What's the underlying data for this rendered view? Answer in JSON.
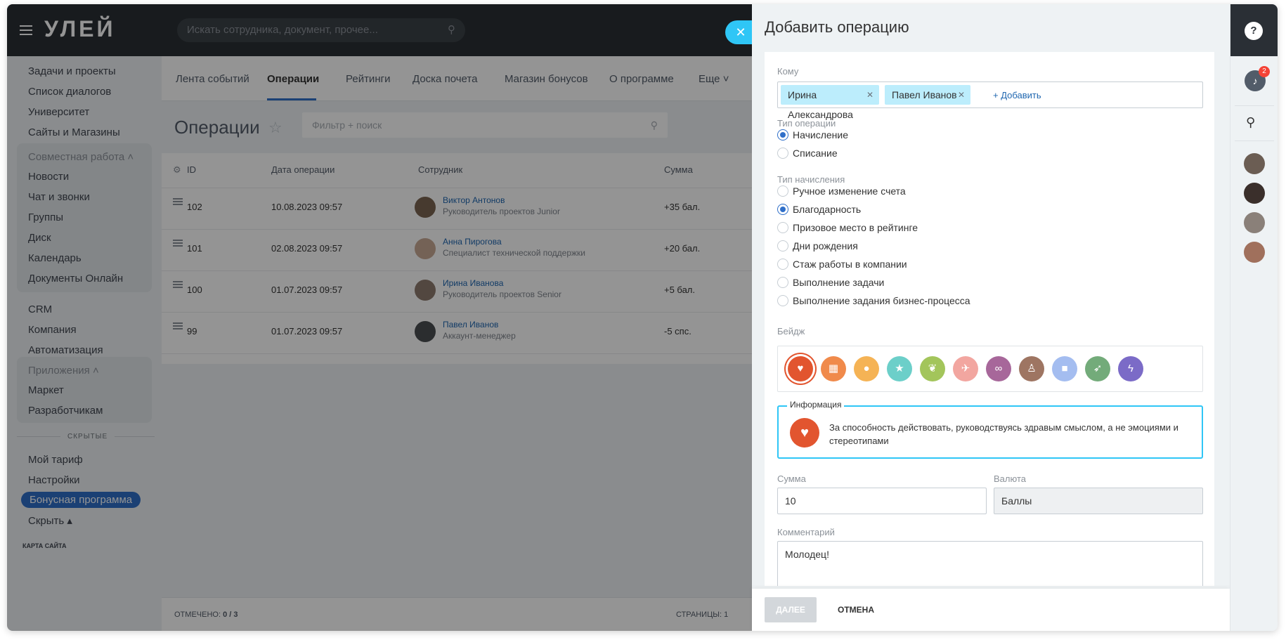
{
  "header": {
    "logo": "УЛЕЙ",
    "search_placeholder": "Искать сотрудника, документ, прочее..."
  },
  "sidebar": {
    "items_top": [
      "Задачи и проекты",
      "Список диалогов",
      "Университет",
      "Сайты и Магазины"
    ],
    "group1_title": "Совместная работа",
    "group1_items": [
      "Новости",
      "Чат и звонки",
      "Группы",
      "Диск",
      "Календарь",
      "Документы Онлайн"
    ],
    "items_mid": [
      "CRM",
      "Компания",
      "Автоматизация"
    ],
    "group2_title": "Приложения",
    "group2_items": [
      "Маркет",
      "Разработчикам"
    ],
    "hidden_label": "СКРЫТЫЕ",
    "items_bottom": [
      "Мой тариф",
      "Настройки"
    ],
    "active_item": "Бонусная программа",
    "hide_label": "Скрыть",
    "sitemap_label": "КАРТА САЙТА"
  },
  "tabs": [
    "Лента событий",
    "Операции",
    "Рейтинги",
    "Доска почета",
    "Магазин бонусов",
    "О программе",
    "Еще"
  ],
  "page": {
    "title": "Операции",
    "filter_placeholder": "Фильтр + поиск"
  },
  "grid": {
    "columns": [
      "ID",
      "Дата операции",
      "Сотрудник",
      "Сумма"
    ],
    "rows": [
      {
        "id": "102",
        "date": "10.08.2023 09:57",
        "name": "Виктор Антонов",
        "position": "Руководитель проектов Junior",
        "sum": "+35 бал."
      },
      {
        "id": "101",
        "date": "02.08.2023 09:57",
        "name": "Анна Пирогова",
        "position": "Специалист технической поддержки",
        "sum": "+20 бал."
      },
      {
        "id": "100",
        "date": "01.07.2023 09:57",
        "name": "Ирина Иванова",
        "position": "Руководитель проектов Senior",
        "sum": "+5 бал."
      },
      {
        "id": "99",
        "date": "01.07.2023 09:57",
        "name": "Павел Иванов",
        "position": "Аккаунт-менеджер",
        "sum": "-5 спс."
      }
    ],
    "footer_selected_label": "ОТМЕЧЕНО:",
    "footer_selected_value": "0 / 3",
    "footer_pages_label": "СТРАНИЦЫ: 1"
  },
  "panel": {
    "title": "Добавить операцию",
    "to_label": "Кому",
    "recipients": [
      "Ирина Александрова",
      "Павел Иванов"
    ],
    "add_link": "+ Добавить",
    "op_type_label": "Тип операции",
    "op_types": [
      {
        "label": "Начисление",
        "checked": true
      },
      {
        "label": "Списание",
        "checked": false
      }
    ],
    "accrual_type_label": "Тип начисления",
    "accrual_types": [
      {
        "label": "Ручное изменение счета",
        "checked": false
      },
      {
        "label": "Благодарность",
        "checked": true
      },
      {
        "label": "Призовое место в рейтинге",
        "checked": false
      },
      {
        "label": "Дни рождения",
        "checked": false
      },
      {
        "label": "Стаж работы в компании",
        "checked": false
      },
      {
        "label": "Выполнение задачи",
        "checked": false
      },
      {
        "label": "Выполнение задания бизнес-процесса",
        "checked": false
      }
    ],
    "badge_label": "Бейдж",
    "badges": [
      {
        "icon": "heart-icon",
        "glyph": "♥",
        "color": "#e2552f",
        "selected": true
      },
      {
        "icon": "cake-icon",
        "glyph": "▦",
        "color": "#f08a4b",
        "selected": false
      },
      {
        "icon": "chat-icon",
        "glyph": "●",
        "color": "#f5b355",
        "selected": false
      },
      {
        "icon": "star-icon",
        "glyph": "★",
        "color": "#6ccfc9",
        "selected": false
      },
      {
        "icon": "leaf-icon",
        "glyph": "❦",
        "color": "#a3c55b",
        "selected": false
      },
      {
        "icon": "plane-icon",
        "glyph": "✈",
        "color": "#f2a6a0",
        "selected": false
      },
      {
        "icon": "binoculars-icon",
        "glyph": "∞",
        "color": "#a7679a",
        "selected": false
      },
      {
        "icon": "person-icon",
        "glyph": "♙",
        "color": "#9e7562",
        "selected": false
      },
      {
        "icon": "gift-icon",
        "glyph": "■",
        "color": "#a4bdf0",
        "selected": false
      },
      {
        "icon": "rocket-icon",
        "glyph": "➶",
        "color": "#73ab7a",
        "selected": false
      },
      {
        "icon": "bolt-icon",
        "glyph": "ϟ",
        "color": "#7b6bc7",
        "selected": false
      }
    ],
    "info_label": "Информация",
    "info_text": "За способность действовать, руководствуясь здравым смыслом, а не эмоциями и стереотипами",
    "sum_label": "Сумма",
    "sum_value": "10",
    "currency_label": "Валюта",
    "currency_value": "Баллы",
    "comment_label": "Комментарий",
    "comment_value": "Молодец!",
    "next_button": "ДАЛЕЕ",
    "cancel_button": "ОТМЕНА"
  },
  "rail": {
    "help_glyph": "?",
    "notification_count": "2"
  },
  "colors": {
    "accent": "#2f6fc9",
    "close_button": "#2fc6f6",
    "chip": "#bcedfc",
    "dark_header": "#2a2f35"
  }
}
